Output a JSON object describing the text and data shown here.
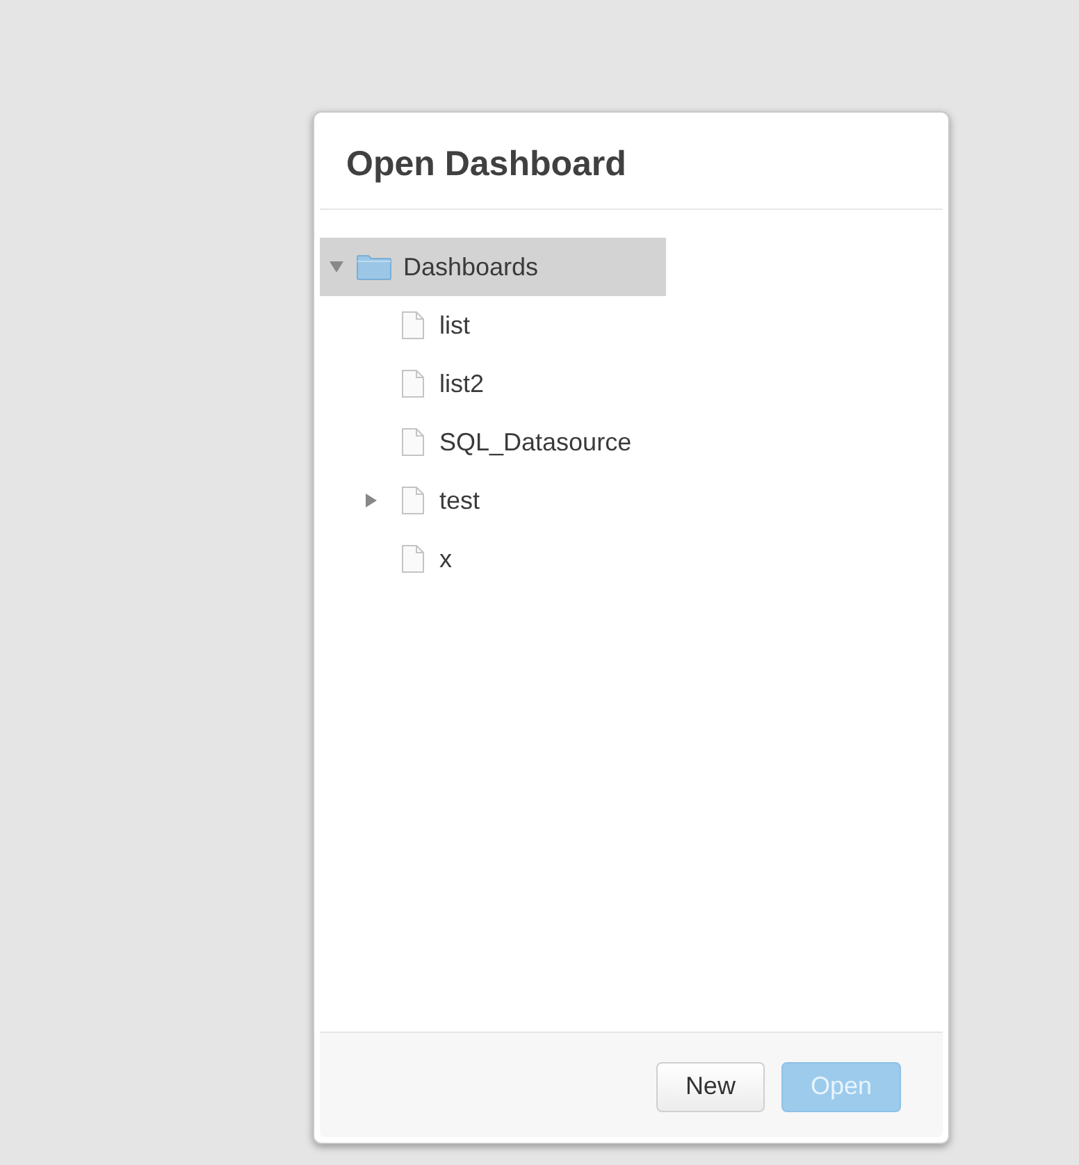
{
  "dialog": {
    "title": "Open Dashboard"
  },
  "tree": {
    "label": "Dashboards",
    "expanded": true,
    "selected": true,
    "children": [
      {
        "label": "list",
        "has_children": false,
        "selected": false
      },
      {
        "label": "list2",
        "has_children": false,
        "selected": false
      },
      {
        "label": "SQL_Datasource",
        "has_children": false,
        "selected": false
      },
      {
        "label": "test",
        "has_children": true,
        "selected": false
      },
      {
        "label": "x",
        "has_children": false,
        "selected": false
      }
    ]
  },
  "buttons": [
    {
      "label": "New",
      "kind": "default",
      "disabled": false
    },
    {
      "label": "Open",
      "kind": "primary",
      "disabled": true
    }
  ]
}
